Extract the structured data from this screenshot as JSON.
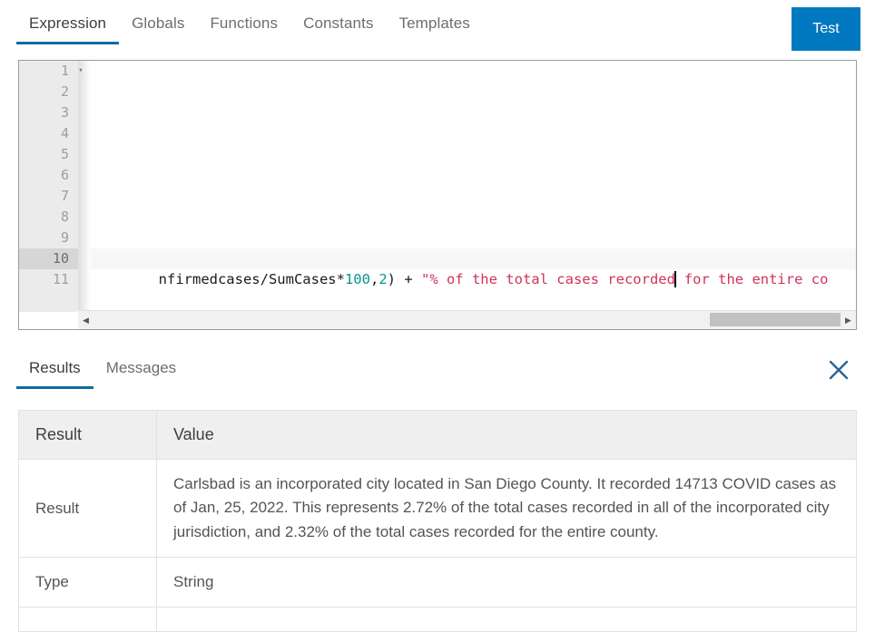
{
  "top_tabs": {
    "items": [
      {
        "label": "Expression",
        "active": true
      },
      {
        "label": "Globals",
        "active": false
      },
      {
        "label": "Functions",
        "active": false
      },
      {
        "label": "Constants",
        "active": false
      },
      {
        "label": "Templates",
        "active": false
      }
    ],
    "test_button_label": "Test",
    "accent_color": "#0079c1",
    "underline_color": "#0f6c9c"
  },
  "editor": {
    "line_numbers": [
      "1",
      "2",
      "3",
      "4",
      "5",
      "6",
      "7",
      "8",
      "9",
      "10",
      "11"
    ],
    "active_line": "10",
    "fold_marker": "▾",
    "code_line_10": {
      "segments": [
        {
          "text": "nfirmedcases/SumCases*",
          "type": "plain"
        },
        {
          "text": "100",
          "type": "number"
        },
        {
          "text": ",",
          "type": "plain"
        },
        {
          "text": "2",
          "type": "number"
        },
        {
          "text": ") + ",
          "type": "plain"
        },
        {
          "text": "\"% of the total cases recorded",
          "type": "string"
        },
        {
          "text": "caret",
          "type": "caret"
        },
        {
          "text": " for the entire co",
          "type": "string"
        }
      ],
      "plain_text": "nfirmedcases/SumCases*100,2) + \"% of the total cases recorded for the entire co"
    },
    "syntax_colors": {
      "plain": "#1b1b1b",
      "number": "#0a9396",
      "string": "#d1325b"
    },
    "scrollbar": {
      "left_arrow": "◀",
      "right_arrow": "▶",
      "thumb_position_percent": 82.5,
      "thumb_width_percent": 17.5
    }
  },
  "results_panel": {
    "tabs": [
      {
        "label": "Results",
        "active": true
      },
      {
        "label": "Messages",
        "active": false
      }
    ],
    "close_icon_label": "✕",
    "close_icon_color": "#2a6496",
    "table": {
      "headers": [
        "Result",
        "Value"
      ],
      "rows": [
        {
          "key": "Result",
          "value": "Carlsbad is an incorporated city located in San Diego County. It recorded 14713 COVID cases as of Jan, 25, 2022. This represents 2.72% of the total cases recorded in all of the incorporated city jurisdiction, and 2.32% of the total cases recorded for the entire county."
        },
        {
          "key": "Type",
          "value": "String"
        }
      ]
    }
  }
}
